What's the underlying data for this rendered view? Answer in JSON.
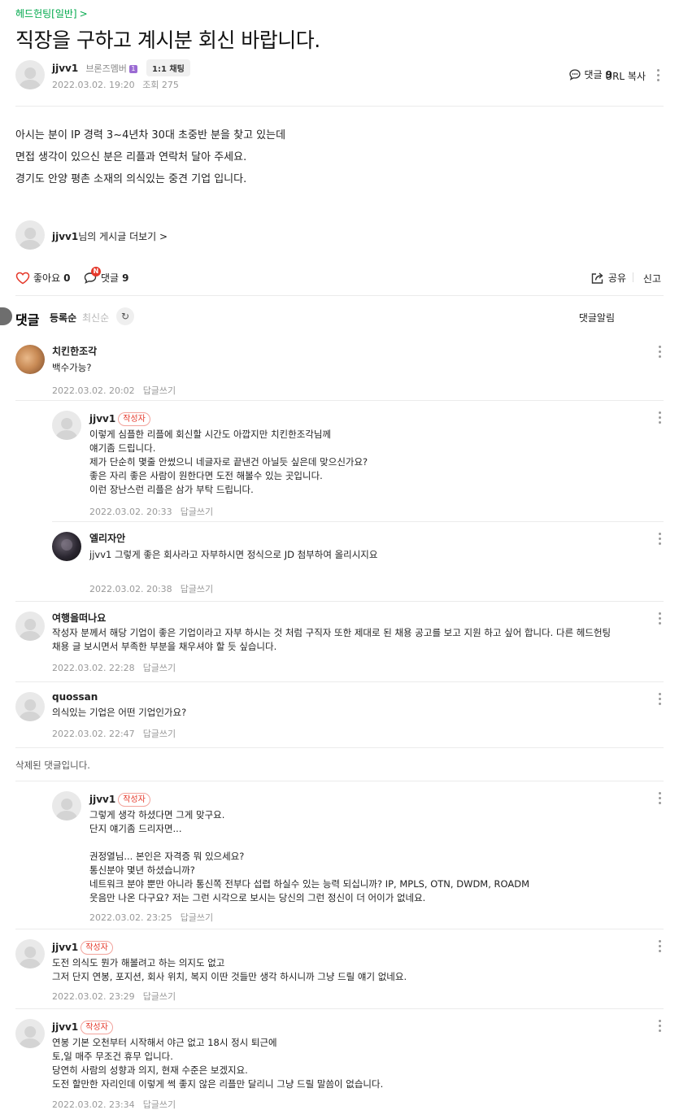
{
  "board": {
    "breadcrumb": "헤드헌팅[일반]"
  },
  "post": {
    "title": "직장을 구하고 계시분 회신 바랍니다.",
    "author": "jjvv1",
    "member_level": "브론즈멤버",
    "grade_mark": "1",
    "chat_label": "1:1 채팅",
    "date": "2022.03.02. 19:20",
    "views": "조회 275",
    "comment_label": "댓글",
    "comment_count": "9",
    "url_copy": "URL 복사",
    "body_lines": [
      "아시는 분이 IP 경력 3~4년차 30대 초중반 분을 찾고 있는데",
      "면접 생각이 있으신 분은 리플과 연락처 달아 주세요.",
      "경기도 안양 평촌 소재의 의식있는 중견 기업 입니다."
    ],
    "more_posts_name": "jjvv1",
    "more_posts_label": "님의 게시글 더보기",
    "like_label": "좋아요",
    "like_count": "0",
    "new_badge": "N",
    "share_label": "공유",
    "report_label": "신고"
  },
  "comments_header": {
    "title": "댓글",
    "sort_registered": "등록순",
    "sort_latest": "최신순",
    "alarm_label": "댓글알림"
  },
  "comments": [
    {
      "name": "치킨한조각",
      "author": false,
      "text": "백수가능?",
      "date": "2022.03.02. 20:02",
      "reply": "답글쓰기"
    },
    {
      "name": "jjvv1",
      "author": true,
      "badge": "작성자",
      "text": "이렇게 심플한 리플에 회신할 시간도 아깝지만 치킨한조각님께\n얘기좀 드립니다.\n제가 단순히 몇줄 안썼으니 네글자로 끝낸건 아닐듯 싶은데 맞으신가요?\n좋은 자리 좋은 사람이 원한다면 도전 해볼수 있는 곳입니다.\n이런 장난스런 리플은 삼가 부탁 드립니다.",
      "date": "2022.03.02. 20:33",
      "reply": "답글쓰기"
    },
    {
      "name": "엘리자안",
      "author": false,
      "text": "jjvv1 그렇게 좋은 회사라고 자부하시면 정식으로 JD 첨부하여 올리시지요",
      "mention": "jjvv1",
      "date": "2022.03.02. 20:38",
      "reply": "답글쓰기"
    },
    {
      "name": "여행을떠나요",
      "author": false,
      "text": "작성자 분께서 해당 기업이 좋은 기업이라고 자부 하시는 것 처럼 구직자 또한 제대로 된 채용 공고를 보고 지원 하고 싶어 합니다. 다른 헤드헌팅\n채용 글 보시면서 부족한 부분을 채우셔야 할 듯 싶습니다.",
      "date": "2022.03.02. 22:28",
      "reply": "답글쓰기"
    },
    {
      "name": "quossan",
      "author": false,
      "text": "의식있는 기업은 어떤 기업인가요?",
      "date": "2022.03.02. 22:47",
      "reply": "답글쓰기"
    },
    {
      "deleted_text": "삭제된 댓글입니다."
    },
    {
      "name": "jjvv1",
      "author": true,
      "badge": "작성자",
      "text": "그렇게 생각 하셨다면 그게 맞구요.\n단지 얘기좀 드리자면...\n\n권정열님... 본인은 자격증 뭐 있으세요?\n통신분야 몇년 하셨습니까?\n네트워크 분야 뿐만 아니라 통신쪽 전부다 섭렵 하실수 있는 능력 되십니까? IP, MPLS, OTN, DWDM, ROADM\n웃음만 나온 다구요? 저는 그런 시각으로 보시는 당신의 그런 정신이 더 어이가 없네요.",
      "date": "2022.03.02. 23:25",
      "reply": "답글쓰기"
    },
    {
      "name": "jjvv1",
      "author": true,
      "badge": "작성자",
      "text": "도전 의식도 뭔가 해볼려고 하는 의지도 없고\n그저 단지 연봉, 포지션, 회사 위치, 복지 이딴 것들만 생각 하시니까 그냥 드릴 얘기 없네요.",
      "date": "2022.03.02. 23:29",
      "reply": "답글쓰기"
    },
    {
      "name": "jjvv1",
      "author": true,
      "badge": "작성자",
      "text": "연봉 기본 오천부터 시작해서 야근 없고 18시 정시 퇴근에\n토,일 매주 무조건 휴무 입니다.\n당연히 사람의 성향과 의지, 현재 수준은 보겠지요.\n도전 할만한 자리인데 이렇게 썩 좋지 않은 리플만 달리니 그냥 드릴 말씀이 없습니다.",
      "date": "2022.03.02. 23:34",
      "reply": "답글쓰기"
    }
  ],
  "colors": {
    "accent_green": "#03a94d",
    "author_badge_red": "#e5392b",
    "grade_purple": "#9b6bd3",
    "toggle_off": "#6e6e6e"
  }
}
